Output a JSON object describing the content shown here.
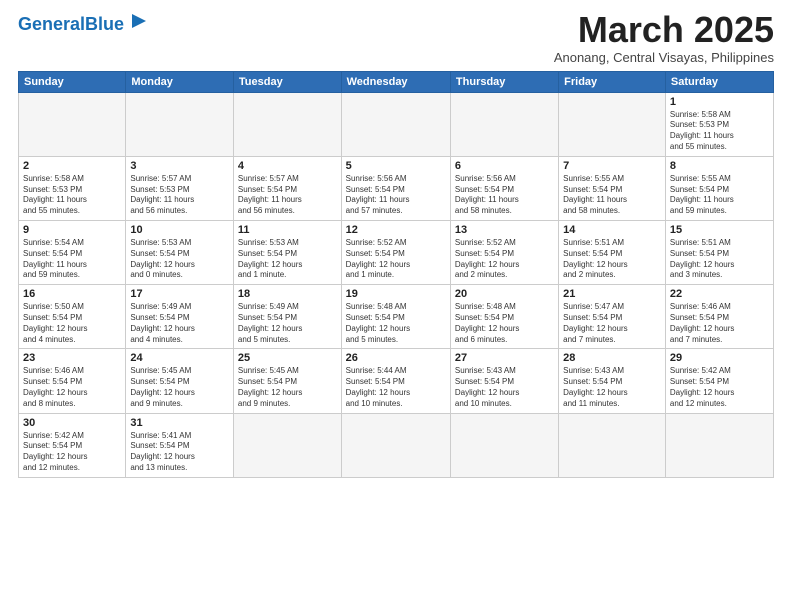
{
  "header": {
    "logo_general": "General",
    "logo_blue": "Blue",
    "month_year": "March 2025",
    "location": "Anonang, Central Visayas, Philippines"
  },
  "columns": [
    "Sunday",
    "Monday",
    "Tuesday",
    "Wednesday",
    "Thursday",
    "Friday",
    "Saturday"
  ],
  "weeks": [
    [
      {
        "day": "",
        "info": ""
      },
      {
        "day": "",
        "info": ""
      },
      {
        "day": "",
        "info": ""
      },
      {
        "day": "",
        "info": ""
      },
      {
        "day": "",
        "info": ""
      },
      {
        "day": "",
        "info": ""
      },
      {
        "day": "1",
        "info": "Sunrise: 5:58 AM\nSunset: 5:53 PM\nDaylight: 11 hours\nand 55 minutes."
      }
    ],
    [
      {
        "day": "2",
        "info": "Sunrise: 5:58 AM\nSunset: 5:53 PM\nDaylight: 11 hours\nand 55 minutes."
      },
      {
        "day": "3",
        "info": "Sunrise: 5:57 AM\nSunset: 5:53 PM\nDaylight: 11 hours\nand 56 minutes."
      },
      {
        "day": "4",
        "info": "Sunrise: 5:57 AM\nSunset: 5:54 PM\nDaylight: 11 hours\nand 56 minutes."
      },
      {
        "day": "5",
        "info": "Sunrise: 5:56 AM\nSunset: 5:54 PM\nDaylight: 11 hours\nand 57 minutes."
      },
      {
        "day": "6",
        "info": "Sunrise: 5:56 AM\nSunset: 5:54 PM\nDaylight: 11 hours\nand 58 minutes."
      },
      {
        "day": "7",
        "info": "Sunrise: 5:55 AM\nSunset: 5:54 PM\nDaylight: 11 hours\nand 58 minutes."
      },
      {
        "day": "8",
        "info": "Sunrise: 5:55 AM\nSunset: 5:54 PM\nDaylight: 11 hours\nand 59 minutes."
      }
    ],
    [
      {
        "day": "9",
        "info": "Sunrise: 5:54 AM\nSunset: 5:54 PM\nDaylight: 11 hours\nand 59 minutes."
      },
      {
        "day": "10",
        "info": "Sunrise: 5:53 AM\nSunset: 5:54 PM\nDaylight: 12 hours\nand 0 minutes."
      },
      {
        "day": "11",
        "info": "Sunrise: 5:53 AM\nSunset: 5:54 PM\nDaylight: 12 hours\nand 1 minute."
      },
      {
        "day": "12",
        "info": "Sunrise: 5:52 AM\nSunset: 5:54 PM\nDaylight: 12 hours\nand 1 minute."
      },
      {
        "day": "13",
        "info": "Sunrise: 5:52 AM\nSunset: 5:54 PM\nDaylight: 12 hours\nand 2 minutes."
      },
      {
        "day": "14",
        "info": "Sunrise: 5:51 AM\nSunset: 5:54 PM\nDaylight: 12 hours\nand 2 minutes."
      },
      {
        "day": "15",
        "info": "Sunrise: 5:51 AM\nSunset: 5:54 PM\nDaylight: 12 hours\nand 3 minutes."
      }
    ],
    [
      {
        "day": "16",
        "info": "Sunrise: 5:50 AM\nSunset: 5:54 PM\nDaylight: 12 hours\nand 4 minutes."
      },
      {
        "day": "17",
        "info": "Sunrise: 5:49 AM\nSunset: 5:54 PM\nDaylight: 12 hours\nand 4 minutes."
      },
      {
        "day": "18",
        "info": "Sunrise: 5:49 AM\nSunset: 5:54 PM\nDaylight: 12 hours\nand 5 minutes."
      },
      {
        "day": "19",
        "info": "Sunrise: 5:48 AM\nSunset: 5:54 PM\nDaylight: 12 hours\nand 5 minutes."
      },
      {
        "day": "20",
        "info": "Sunrise: 5:48 AM\nSunset: 5:54 PM\nDaylight: 12 hours\nand 6 minutes."
      },
      {
        "day": "21",
        "info": "Sunrise: 5:47 AM\nSunset: 5:54 PM\nDaylight: 12 hours\nand 7 minutes."
      },
      {
        "day": "22",
        "info": "Sunrise: 5:46 AM\nSunset: 5:54 PM\nDaylight: 12 hours\nand 7 minutes."
      }
    ],
    [
      {
        "day": "23",
        "info": "Sunrise: 5:46 AM\nSunset: 5:54 PM\nDaylight: 12 hours\nand 8 minutes."
      },
      {
        "day": "24",
        "info": "Sunrise: 5:45 AM\nSunset: 5:54 PM\nDaylight: 12 hours\nand 9 minutes."
      },
      {
        "day": "25",
        "info": "Sunrise: 5:45 AM\nSunset: 5:54 PM\nDaylight: 12 hours\nand 9 minutes."
      },
      {
        "day": "26",
        "info": "Sunrise: 5:44 AM\nSunset: 5:54 PM\nDaylight: 12 hours\nand 10 minutes."
      },
      {
        "day": "27",
        "info": "Sunrise: 5:43 AM\nSunset: 5:54 PM\nDaylight: 12 hours\nand 10 minutes."
      },
      {
        "day": "28",
        "info": "Sunrise: 5:43 AM\nSunset: 5:54 PM\nDaylight: 12 hours\nand 11 minutes."
      },
      {
        "day": "29",
        "info": "Sunrise: 5:42 AM\nSunset: 5:54 PM\nDaylight: 12 hours\nand 12 minutes."
      }
    ],
    [
      {
        "day": "30",
        "info": "Sunrise: 5:42 AM\nSunset: 5:54 PM\nDaylight: 12 hours\nand 12 minutes."
      },
      {
        "day": "31",
        "info": "Sunrise: 5:41 AM\nSunset: 5:54 PM\nDaylight: 12 hours\nand 13 minutes."
      },
      {
        "day": "",
        "info": ""
      },
      {
        "day": "",
        "info": ""
      },
      {
        "day": "",
        "info": ""
      },
      {
        "day": "",
        "info": ""
      },
      {
        "day": "",
        "info": ""
      }
    ]
  ]
}
